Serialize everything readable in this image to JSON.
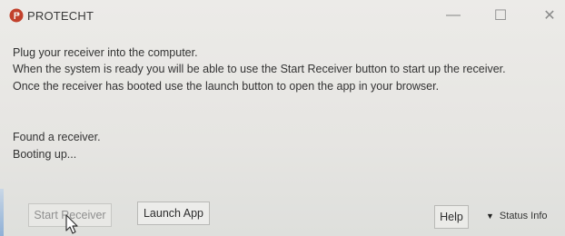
{
  "window": {
    "title": "PROTECHT",
    "controls": {
      "minimize": "—",
      "maximize": "☐",
      "close": "✕"
    },
    "icon": "protecht-logo-icon"
  },
  "message": {
    "line1": "Plug your receiver into the computer.",
    "line2": "When the system is ready you will be able to use the Start Receiver button to start up the receiver.",
    "line3": "Once the receiver has booted use the launch button to open the app in your browser."
  },
  "status": {
    "line1": "Found a receiver.",
    "line2": "Booting up..."
  },
  "buttons": {
    "start_receiver": "Start Receiver",
    "launch_app": "Launch App",
    "help": "Help"
  },
  "status_info": {
    "arrow": "▼",
    "label": "Status Info"
  },
  "colors": {
    "accent_logo": "#c2412c",
    "disabled_text": "#8f8f8f"
  }
}
